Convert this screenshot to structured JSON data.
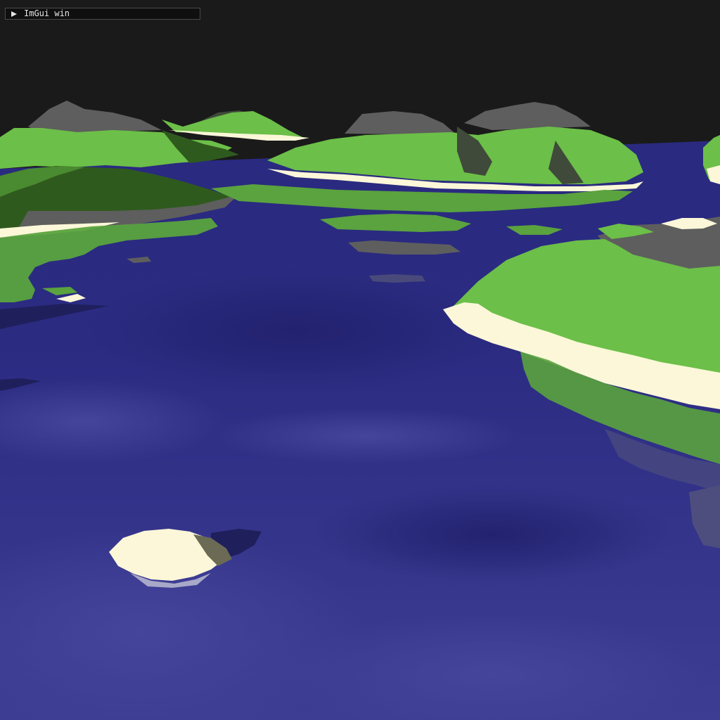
{
  "imgui": {
    "title": "ImGui win",
    "collapsed": true,
    "arrow_icon": "triangle-right-icon"
  },
  "scene": {
    "description_colors": {
      "sky": "#1a1a1a",
      "water_deep": "#262675",
      "water_mid": "#3a3a8f",
      "water_shallow": "#45459a",
      "grass": "#6cbf48",
      "grass_dark": "#2f5a1e",
      "sand": "#fbf7d8",
      "rock": "#5e5e5e",
      "rock_dark": "#3f4a3a"
    }
  }
}
